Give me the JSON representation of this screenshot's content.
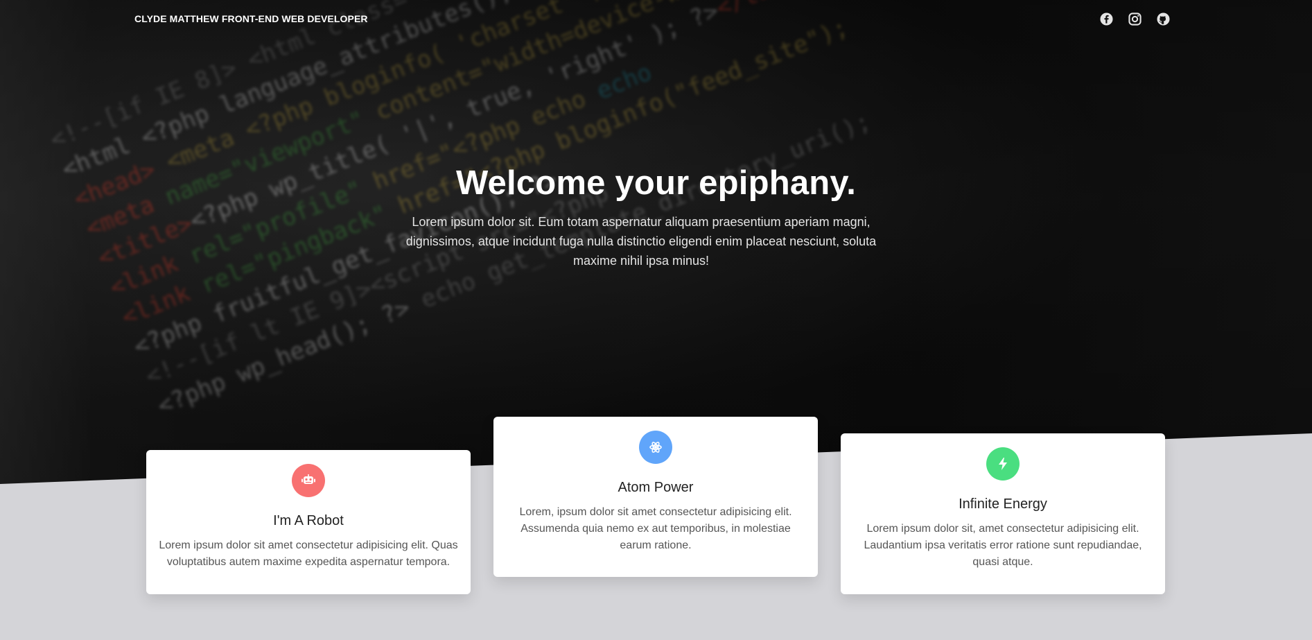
{
  "nav": {
    "brand": "CLYDE MATTHEW FRONT-END WEB DEVELOPER",
    "icons": [
      "facebook-icon",
      "instagram-icon",
      "github-icon"
    ]
  },
  "hero": {
    "title": "Welcome your epiphany.",
    "subtitle": "Lorem ipsum dolor sit. Eum totam aspernatur aliquam praesentium aperiam magni, dignissimos, atque incidunt fuga nulla distinctio eligendi enim placeat nesciunt, soluta maxime nihil ipsa minus!"
  },
  "cards": [
    {
      "title": "I'm A Robot",
      "text": "Lorem ipsum dolor sit amet consectetur adipisicing elit. Quas voluptatibus autem maxime expedita aspernatur tempora.",
      "icon": "robot-icon",
      "color": "#f87171"
    },
    {
      "title": "Atom Power",
      "text": "Lorem, ipsum dolor sit amet consectetur adipisicing elit. Assumenda quia nemo ex aut temporibus, in molestiae earum ratione.",
      "icon": "atom-icon",
      "color": "#60a5fa"
    },
    {
      "title": "Infinite Energy",
      "text": "Lorem ipsum dolor sit, amet consectetur adipisicing elit. Laudantium ipsa veritatis error ratione sunt repudiandae, quasi atque.",
      "icon": "bolt-icon",
      "color": "#4ade80"
    }
  ],
  "colors": {
    "hero_background": "#121212",
    "section_background": "#d4d4d8",
    "card_background": "#ffffff"
  }
}
